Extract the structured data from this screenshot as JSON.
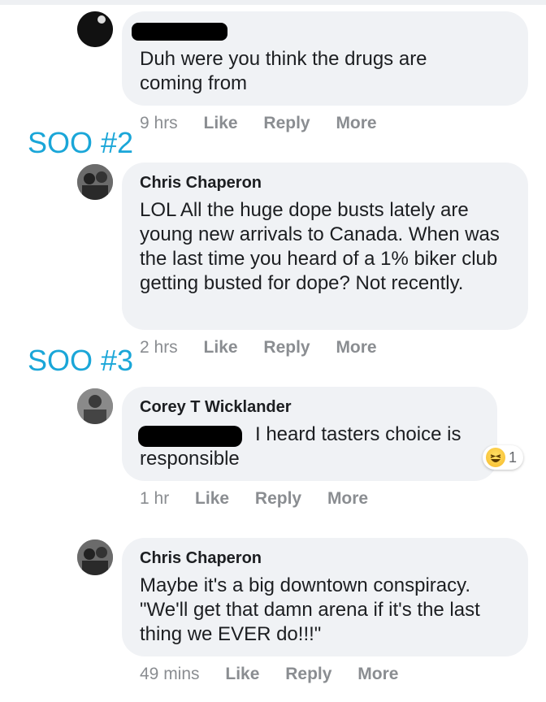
{
  "comments": [
    {
      "author": "",
      "text": "Duh were you think the drugs are coming from",
      "time": "9 hrs"
    },
    {
      "author": "Chris Chaperon",
      "text": "LOL All the huge dope busts lately are young new arrivals to Canada. When was the last time you heard of a 1% biker club getting busted for dope? Not recently.",
      "time": "2 hrs"
    },
    {
      "author": "Corey T Wicklander",
      "text_line1": "I heard tasters choice is",
      "text_line2": "responsible",
      "time": "1 hr",
      "reaction": {
        "icon": "haha-emoji-icon",
        "count": "1"
      }
    },
    {
      "author": "Chris Chaperon",
      "text": "Maybe it's a big downtown conspiracy. \"We'll get that damn arena if it's the last thing we EVER do!!!\"",
      "time": "49 mins"
    }
  ],
  "actions": {
    "like": "Like",
    "reply": "Reply",
    "more": "More"
  },
  "markers": {
    "soo2": "SOO #2",
    "soo3": "SOO #3"
  },
  "colors": {
    "marker": "#1aa6d8",
    "bubble": "#f0f2f5",
    "meta": "#8a8d91"
  }
}
